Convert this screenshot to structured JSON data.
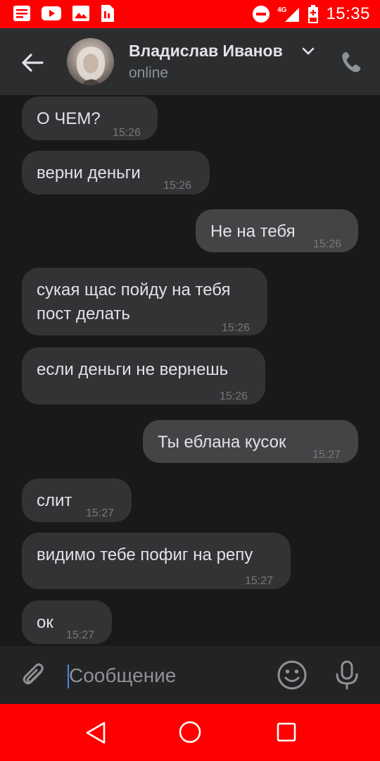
{
  "statusbar": {
    "time": "15:35",
    "network": "4G"
  },
  "header": {
    "contact_name": "Владислав Иванов",
    "status": "online"
  },
  "messages": [
    {
      "text": "О ЧЕМ?",
      "time": "15:26",
      "direction": "in"
    },
    {
      "text": "верни деньги",
      "time": "15:26",
      "direction": "in"
    },
    {
      "text": "Не на тебя",
      "time": "15:26",
      "direction": "out"
    },
    {
      "text": "сукая щас пойду на тебя\nпост делать",
      "time": "15:26",
      "direction": "in"
    },
    {
      "text": "если деньги не вернешь",
      "time": "15:26",
      "direction": "in"
    },
    {
      "text": "Ты еблана кусок",
      "time": "15:27",
      "direction": "out"
    },
    {
      "text": "слит",
      "time": "15:27",
      "direction": "in"
    },
    {
      "text": "видимо тебе пофиг на репу",
      "time": "15:27",
      "direction": "in"
    },
    {
      "text": "ок",
      "time": "15:27",
      "direction": "in"
    }
  ],
  "composer": {
    "placeholder": "Сообщение"
  },
  "colors": {
    "status_bar": "#fe0000",
    "header_bg": "#2c2d2e",
    "chat_bg": "#19191a",
    "incoming_bubble": "#333335",
    "outgoing_bubble": "#444446"
  },
  "icons": {
    "back": "arrow-left-icon",
    "call": "phone-icon",
    "attach": "paperclip-icon",
    "emoji": "smile-icon",
    "voice": "microphone-icon"
  }
}
